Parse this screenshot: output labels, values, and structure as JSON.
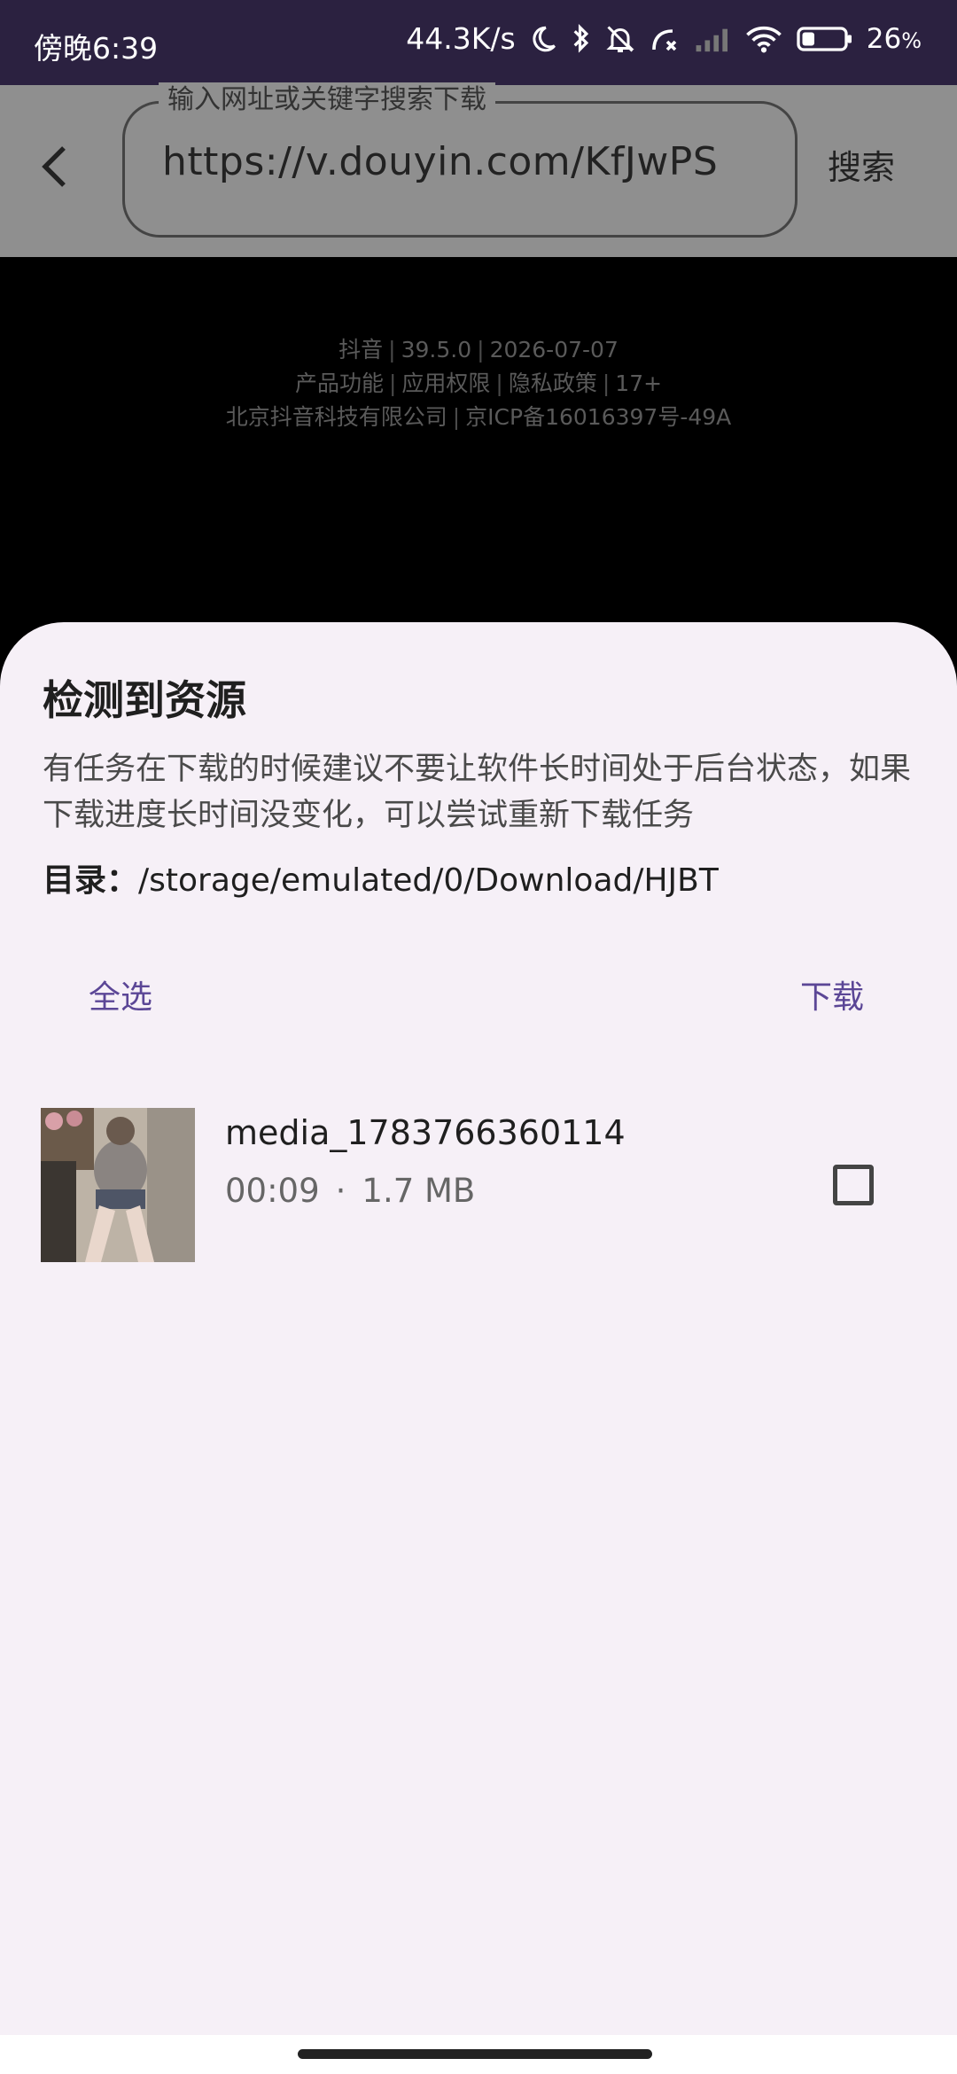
{
  "status_bar": {
    "time": "傍晚6:39",
    "network_speed": "44.3K/s",
    "battery_percent": "26",
    "battery_unit": "%",
    "icons": [
      "moon-icon",
      "bluetooth-icon",
      "mute-bell-icon",
      "call-forward-icon",
      "signal-icon",
      "wifi-icon",
      "battery-icon"
    ]
  },
  "top_bar": {
    "search_legend": "输入网址或关键字搜索下载",
    "search_value": "https://v.douyin.com/KfJwPS",
    "search_button": "搜索"
  },
  "web_info": {
    "line1": [
      "抖音",
      "39.5.0",
      "2026-07-07"
    ],
    "line2": [
      "产品功能",
      "应用权限",
      "隐私政策",
      "17+"
    ],
    "line3": [
      "北京抖音科技有限公司",
      "京ICP备16016397号-49A"
    ]
  },
  "sheet": {
    "title": "检测到资源",
    "description": "有任务在下载的时候建议不要让软件长时间处于后台状态，如果下载进度长时间没变化，可以尝试重新下载任务",
    "dir_label": "目录：",
    "dir_path": "/storage/emulated/0/Download/HJBT",
    "select_all": "全选",
    "download": "下载",
    "items": [
      {
        "name": "media_1783766360114",
        "duration": "00:09",
        "separator": "·",
        "size": "1.7 MB",
        "checked": false
      }
    ]
  },
  "colors": {
    "status_bar_bg": "#2b2140",
    "accent": "#5b4696",
    "sheet_bg": "#f6f0f7"
  }
}
